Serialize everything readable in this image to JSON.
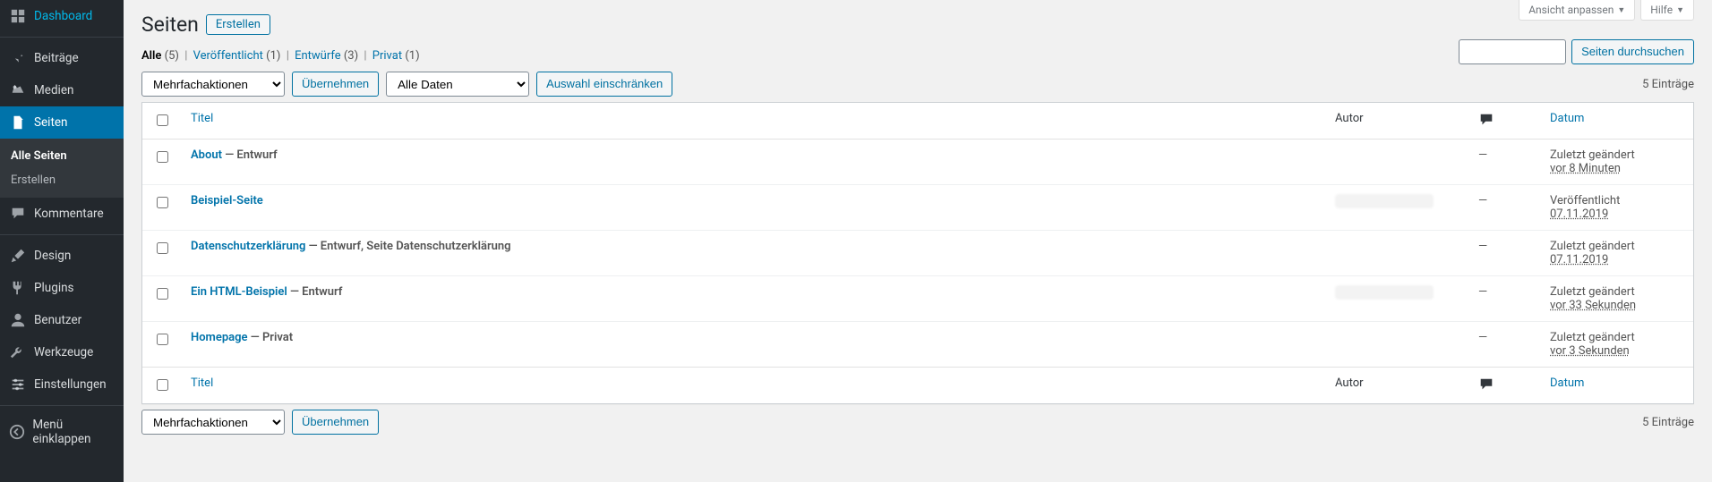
{
  "screen_meta": {
    "view": "Ansicht anpassen",
    "help": "Hilfe"
  },
  "sidebar": {
    "items": [
      {
        "icon": "dashboard",
        "label": "Dashboard"
      },
      {
        "icon": "pin",
        "label": "Beiträge"
      },
      {
        "icon": "media",
        "label": "Medien"
      },
      {
        "icon": "page",
        "label": "Seiten",
        "current": true
      },
      {
        "icon": "comment",
        "label": "Kommentare"
      },
      {
        "icon": "brush",
        "label": "Design"
      },
      {
        "icon": "plug",
        "label": "Plugins"
      },
      {
        "icon": "user",
        "label": "Benutzer"
      },
      {
        "icon": "wrench",
        "label": "Werkzeuge"
      },
      {
        "icon": "sliders",
        "label": "Einstellungen"
      },
      {
        "icon": "collapse",
        "label": "Menü einklappen"
      }
    ],
    "submenu": [
      {
        "label": "Alle Seiten",
        "current": true
      },
      {
        "label": "Erstellen"
      }
    ]
  },
  "heading": "Seiten",
  "add_new": "Erstellen",
  "search": {
    "button": "Seiten durchsuchen",
    "value": ""
  },
  "views": [
    {
      "label": "Alle",
      "count": "(5)",
      "current": true
    },
    {
      "label": "Veröffentlicht",
      "count": "(1)"
    },
    {
      "label": "Entwürfe",
      "count": "(3)"
    },
    {
      "label": "Privat",
      "count": "(1)"
    }
  ],
  "bulk": {
    "placeholder": "Mehrfachaktionen",
    "apply": "Übernehmen"
  },
  "date_filter": {
    "placeholder": "Alle Daten",
    "filter": "Auswahl einschränken"
  },
  "count_label": "5 Einträge",
  "columns": {
    "title": "Titel",
    "author": "Autor",
    "comments_icon": "comment",
    "date": "Datum"
  },
  "rows": [
    {
      "title": "About",
      "state": "Entwurf",
      "author": "",
      "comments": "—",
      "date_status": "Zuletzt geändert",
      "date_value": "vor 8 Minuten"
    },
    {
      "title": "Beispiel-Seite",
      "state": "",
      "author": "[blur]",
      "comments": "—",
      "date_status": "Veröffentlicht",
      "date_value": "07.11.2019"
    },
    {
      "title": "Datenschutzerklärung",
      "state": "Entwurf, Seite Datenschutzerklärung",
      "author": "",
      "comments": "—",
      "date_status": "Zuletzt geändert",
      "date_value": "07.11.2019"
    },
    {
      "title": "Ein HTML-Beispiel",
      "state": "Entwurf",
      "author": "[blur]",
      "comments": "—",
      "date_status": "Zuletzt geändert",
      "date_value": "vor 33 Sekunden"
    },
    {
      "title": "Homepage",
      "state": "Privat",
      "author": "",
      "comments": "—",
      "date_status": "Zuletzt geändert",
      "date_value": "vor 3 Sekunden"
    }
  ]
}
